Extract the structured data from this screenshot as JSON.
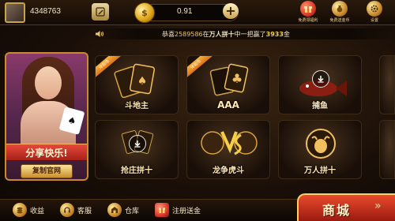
{
  "header": {
    "user_id": "4348763",
    "coin_balance": "0.91",
    "plus_label": "+",
    "shortcuts": [
      {
        "label": "免费领福利",
        "icon": "gift-ball-icon",
        "color": "#d83a2a"
      },
      {
        "label": "免费送金币",
        "icon": "coin-bag-icon",
        "color": "#c98a2a"
      },
      {
        "label": "设置",
        "icon": "gear-icon",
        "color": "#c98a2a"
      }
    ]
  },
  "marquee": {
    "player": "恭喜",
    "player_id": "2589586",
    "middle": "在",
    "game": "万人拼十",
    "win_text": "中一把赢了",
    "amount": "3933",
    "unit": "金"
  },
  "promo": {
    "ribbon": "分享快乐!",
    "copy_button": "复制官网"
  },
  "games": [
    {
      "name": "斗地主",
      "tag": "体验场",
      "downloadable": false
    },
    {
      "name": "AAA",
      "tag": "体验场",
      "downloadable": false
    },
    {
      "name": "捕鱼",
      "tag": "",
      "downloadable": true
    },
    {
      "name": "抢庄拼十",
      "tag": "",
      "downloadable": true
    },
    {
      "name": "龙争虎斗",
      "tag": "",
      "downloadable": false
    },
    {
      "name": "万人拼十",
      "tag": "",
      "downloadable": false
    }
  ],
  "bottom_nav": [
    {
      "label": "收益",
      "icon": "coin-stack-icon"
    },
    {
      "label": "客服",
      "icon": "headset-icon"
    },
    {
      "label": "仓库",
      "icon": "warehouse-icon"
    },
    {
      "label": "注册送金",
      "icon": "gift-box-icon"
    }
  ],
  "shop": {
    "label": "商城",
    "arrow": "»"
  },
  "colors": {
    "accent_gold": "#e9c46a",
    "shop_red": "#d8352a",
    "promo_ribbon": "#e8483a"
  }
}
